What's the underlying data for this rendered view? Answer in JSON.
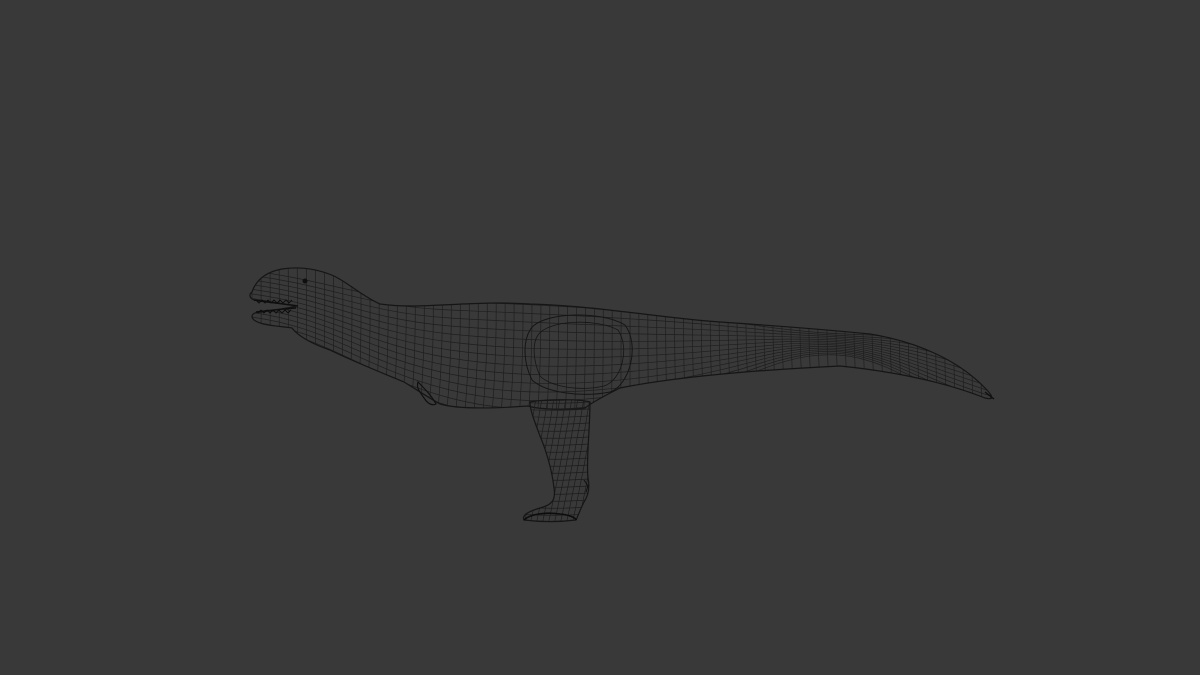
{
  "viewport": {
    "background_color": "#393939",
    "wire_color": "#1a1a1a",
    "object": "dinosaur-wireframe-mesh"
  }
}
